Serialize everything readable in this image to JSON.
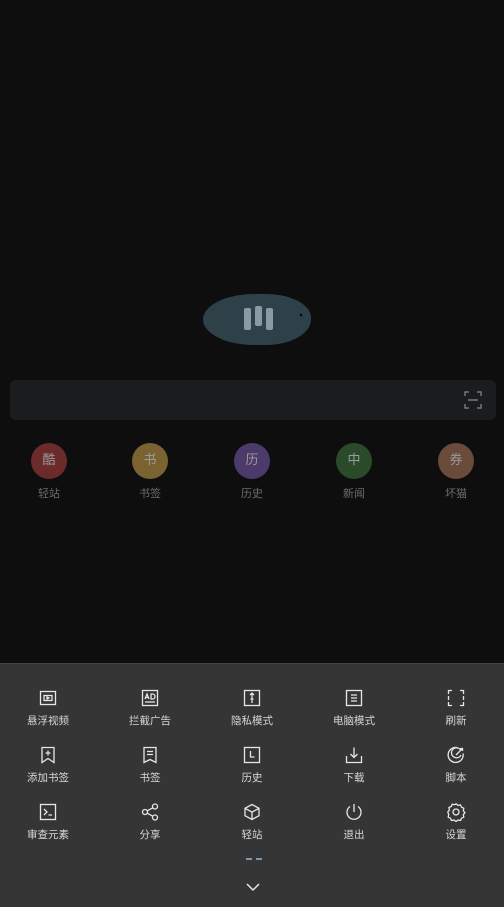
{
  "shortcuts": [
    {
      "glyph": "酷",
      "label": "轻站",
      "color": "#6b2b2a"
    },
    {
      "glyph": "书",
      "label": "书签",
      "color": "#7a6330"
    },
    {
      "glyph": "历",
      "label": "历史",
      "color": "#4b3a6a"
    },
    {
      "glyph": "中",
      "label": "新闻",
      "color": "#2b4a2a"
    },
    {
      "glyph": "券",
      "label": "坏猫",
      "color": "#6a4a3a"
    }
  ],
  "menu": {
    "row1": [
      {
        "label": "悬浮视频",
        "icon": "floating-video-icon"
      },
      {
        "label": "拦截广告",
        "icon": "ad-block-icon"
      },
      {
        "label": "隐私模式",
        "icon": "privacy-mode-icon"
      },
      {
        "label": "电脑模式",
        "icon": "desktop-mode-icon"
      },
      {
        "label": "刷新",
        "icon": "refresh-icon"
      }
    ],
    "row2": [
      {
        "label": "添加书签",
        "icon": "add-bookmark-icon"
      },
      {
        "label": "书签",
        "icon": "bookmarks-icon"
      },
      {
        "label": "历史",
        "icon": "history-icon"
      },
      {
        "label": "下载",
        "icon": "download-icon"
      },
      {
        "label": "脚本",
        "icon": "script-icon"
      }
    ],
    "row3": [
      {
        "label": "审查元素",
        "icon": "inspect-element-icon"
      },
      {
        "label": "分享",
        "icon": "share-icon"
      },
      {
        "label": "轻站",
        "icon": "light-site-icon"
      },
      {
        "label": "退出",
        "icon": "power-icon"
      },
      {
        "label": "设置",
        "icon": "settings-icon"
      }
    ]
  },
  "colors": {
    "background": "#0e0e0e",
    "panel": "#353535",
    "logo": "#2e4148"
  }
}
